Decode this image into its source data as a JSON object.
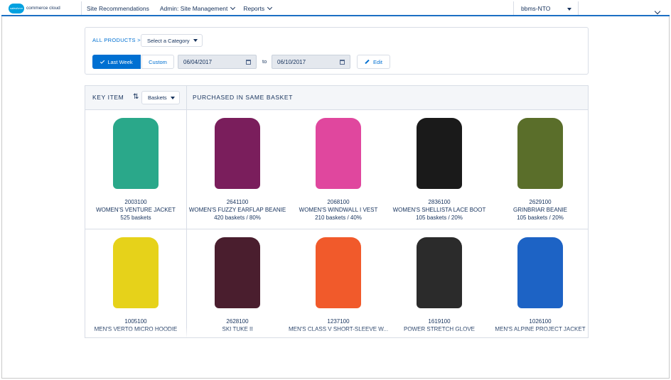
{
  "brand": {
    "logo_text": "commerce cloud",
    "cloud_text": "salesforce"
  },
  "nav": {
    "items": [
      {
        "label": "Site Recommendations"
      },
      {
        "label": "Admin: Site Management"
      },
      {
        "label": "Reports"
      }
    ],
    "site": "bbms-NTO"
  },
  "filters": {
    "breadcrumb": "ALL PRODUCTS >",
    "category": "Select a Category",
    "last_week": "Last Week",
    "custom": "Custom",
    "from": "06/04/2017",
    "to_label": "to",
    "to": "06/10/2017",
    "edit": "Edit"
  },
  "table": {
    "key_header": "KEY ITEM",
    "sort_by": "Baskets",
    "same_header": "PURCHASED IN SAME BASKET",
    "rows": [
      {
        "key": {
          "id": "2003100",
          "name": "WOMEN'S VENTURE JACKET",
          "stat": "525 baskets",
          "color": "#2aa88a"
        },
        "items": [
          {
            "id": "2641100",
            "name": "WOMEN'S FUZZY EARFLAP BEANIE",
            "stat": "420 baskets / 80%",
            "color": "#7a1e5c"
          },
          {
            "id": "2068100",
            "name": "WOMEN'S WINDWALL I VEST",
            "stat": "210 baskets / 40%",
            "color": "#e0479e"
          },
          {
            "id": "2836100",
            "name": "WOMEN'S SHELLISTA LACE BOOT",
            "stat": "105 baskets / 20%",
            "color": "#1a1a1a"
          },
          {
            "id": "2629100",
            "name": "GRINBRIAR BEANIE",
            "stat": "105 baskets / 20%",
            "color": "#5a6e2a"
          }
        ]
      },
      {
        "key": {
          "id": "1005100",
          "name": "MEN'S VERTO MICRO HOODIE",
          "stat": "",
          "color": "#e6d21a"
        },
        "items": [
          {
            "id": "2628100",
            "name": "SKI TUKE II",
            "stat": "",
            "color": "#4a1e2e"
          },
          {
            "id": "1237100",
            "name": "MEN'S CLASS V SHORT-SLEEVE W...",
            "stat": "",
            "color": "#f15a2b"
          },
          {
            "id": "1619100",
            "name": "POWER STRETCH GLOVE",
            "stat": "",
            "color": "#2b2b2b"
          },
          {
            "id": "1026100",
            "name": "MEN'S ALPINE PROJECT JACKET",
            "stat": "",
            "color": "#1d63c5"
          }
        ]
      }
    ]
  }
}
